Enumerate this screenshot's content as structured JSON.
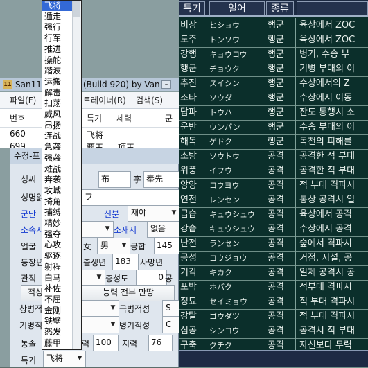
{
  "bg_window": {
    "title": "San11 [?] (Build 920) by Van",
    "title_left": "San11",
    "title_right": "(Build 920) by Van",
    "menus": [
      "파일(F)",
      "트레이너(R)",
      "검색(S)"
    ],
    "list_headers": [
      "번호",
      "특기",
      "세력",
      "군"
    ],
    "rows": [
      {
        "num": "660",
        "tokugi": "飞将"
      },
      {
        "num": "699",
        "a": "覇王",
        "b": "项王"
      }
    ]
  },
  "dialog": {
    "title": "수정-프",
    "labels": {
      "surname": "성씨",
      "given_read": "성명읽",
      "corps": "군단",
      "affiliation": "소속지",
      "face": "얼굴",
      "appear": "등장년",
      "rank": "관직",
      "aptitude": "적성",
      "spear": "창병적",
      "cavalry": "기병적",
      "command": "통솔",
      "special": "특기",
      "status": "신분",
      "territory": "소재지",
      "gender_prefix": "女",
      "relation": "궁합",
      "birth": "출생년",
      "death": "사망년",
      "loyalty": "충성도",
      "war": "력",
      "intellect": "지력",
      "bow": "극병적성",
      "arms": "병기적성",
      "gong": "공"
    },
    "values": {
      "given_name": "布",
      "zi_label": "字",
      "zi": "奉先",
      "name_reading": "フ",
      "status": "재야",
      "territory": "없음",
      "gender": "男",
      "relation": "145",
      "birth": "183",
      "loyalty": "0",
      "war": "100",
      "intellect": "76",
      "bow_grade": "S",
      "arms_grade": "C",
      "special": "飞将"
    },
    "buttons": {
      "max_all": "능력 전부 만땅"
    }
  },
  "dropdown": {
    "items": [
      "飞将",
      "遁走",
      "强行",
      "行军",
      "推进",
      "操舵",
      "踏波",
      "运搬",
      "解毒",
      "扫荡",
      "威风",
      "昂扬",
      "连战",
      "急袭",
      "强袭",
      "难战",
      "奔袭",
      "攻城",
      "掎角",
      "捕缚",
      "精妙",
      "强夺",
      "心攻",
      "驱逐",
      "射程",
      "白马",
      "补佐",
      "不屈",
      "金刚",
      "铁壁",
      "怒发",
      "藤甲"
    ],
    "selected_index": 0
  },
  "game": {
    "headers": [
      "특기",
      "일어",
      "종류"
    ],
    "rows": [
      {
        "ko": "비장",
        "jp": "ヒショウ",
        "type": "행군",
        "desc": "육상에서 ZOC"
      },
      {
        "ko": "도주",
        "jp": "トンソウ",
        "type": "행군",
        "desc": "육상에서 ZOC"
      },
      {
        "ko": "강행",
        "jp": "キョウコウ",
        "type": "행군",
        "desc": "병기, 수송 부"
      },
      {
        "ko": "행군",
        "jp": "チョウク",
        "type": "행군",
        "desc": "기병 부대의 이"
      },
      {
        "ko": "추진",
        "jp": "スイシン",
        "type": "행군",
        "desc": "수상에서의 Z"
      },
      {
        "ko": "조타",
        "jp": "ソウダ",
        "type": "행군",
        "desc": "수상에서 이동"
      },
      {
        "ko": "답파",
        "jp": "トウハ",
        "type": "행군",
        "desc": "잔도 통행시 소"
      },
      {
        "ko": "운반",
        "jp": "ウンパン",
        "type": "행군",
        "desc": "수송 부대의 이"
      },
      {
        "ko": "해독",
        "jp": "ゲドク",
        "type": "행군",
        "desc": "독천의 피해를"
      },
      {
        "ko": "소탕",
        "jp": "ソウトウ",
        "type": "공격",
        "desc": "공격한 적 부대"
      },
      {
        "ko": "위풍",
        "jp": "イフウ",
        "type": "공격",
        "desc": "공격한 적 부대"
      },
      {
        "ko": "앙양",
        "jp": "コウヨウ",
        "type": "공격",
        "desc": "적 부대 격파시"
      },
      {
        "ko": "연전",
        "jp": "レンセン",
        "type": "공격",
        "desc": "통상 공격시 일"
      },
      {
        "ko": "급습",
        "jp": "キュウシュウ",
        "type": "공격",
        "desc": "육상에서 공격"
      },
      {
        "ko": "강습",
        "jp": "キュウシュウ",
        "type": "공격",
        "desc": "수상에서 공격"
      },
      {
        "ko": "난전",
        "jp": "ランセン",
        "type": "공격",
        "desc": "숲에서 격파시"
      },
      {
        "ko": "공성",
        "jp": "コウジョウ",
        "type": "공격",
        "desc": "거점, 시설, 공"
      },
      {
        "ko": "기각",
        "jp": "キカク",
        "type": "공격",
        "desc": "일제 공격시 공"
      },
      {
        "ko": "포박",
        "jp": "ホバク",
        "type": "공격",
        "desc": "적부대 격파시"
      },
      {
        "ko": "정묘",
        "jp": "セイミョウ",
        "type": "공격",
        "desc": "적 부대 격파시"
      },
      {
        "ko": "강탈",
        "jp": "ゴウダツ",
        "type": "공격",
        "desc": "적 부대 격파시"
      },
      {
        "ko": "심공",
        "jp": "シンコウ",
        "type": "공격",
        "desc": "공격시 적 부대"
      },
      {
        "ko": "구축",
        "jp": "クチク",
        "type": "공격",
        "desc": "자신보다 무력"
      },
      {
        "ko": "사정",
        "jp": "シャテイ",
        "type": "공격",
        "desc": "정란, 투석의 사"
      }
    ]
  }
}
